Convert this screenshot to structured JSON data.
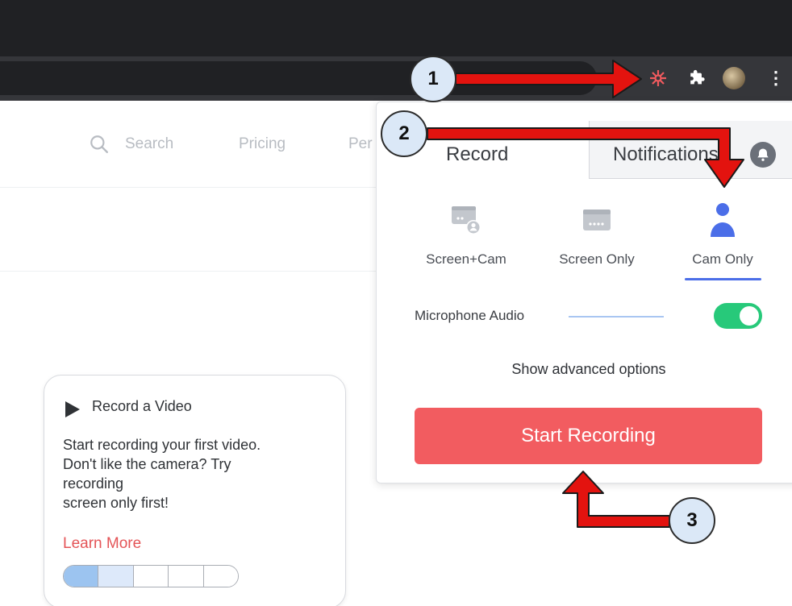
{
  "browser": {
    "extension_icons": [
      "loom-extension-icon",
      "puzzle-extensions-icon",
      "profile-avatar",
      "kebab-menu-icon"
    ],
    "menu_glyph": "⋮"
  },
  "site_nav": {
    "search_label": "Search",
    "pricing_label": "Pricing",
    "partial_label": "Per"
  },
  "popup": {
    "tabs": [
      {
        "label": "Record",
        "active": true
      },
      {
        "label": "Notifications",
        "active": false
      }
    ],
    "modes": [
      {
        "label": "Screen+Cam",
        "icon": "screen-cam-icon",
        "selected": false
      },
      {
        "label": "Screen Only",
        "icon": "screen-only-icon",
        "selected": false
      },
      {
        "label": "Cam Only",
        "icon": "person-icon",
        "selected": true
      }
    ],
    "microphone": {
      "label": "Microphone Audio",
      "enabled": true
    },
    "advanced_label": "Show advanced options",
    "start_label": "Start Recording"
  },
  "card": {
    "title": "Record a Video",
    "body": "Start recording your first video.\nDon't like the camera? Try\nrecording\nscreen only first!",
    "link": "Learn More",
    "progress_steps": 5,
    "progress_completed": 1
  },
  "annotations": [
    "1",
    "2",
    "3"
  ],
  "colors": {
    "accent_red": "#f25c60",
    "toggle_green": "#27c97a",
    "selected_blue": "#4b6ee8",
    "arrow_red": "#e3130f"
  }
}
